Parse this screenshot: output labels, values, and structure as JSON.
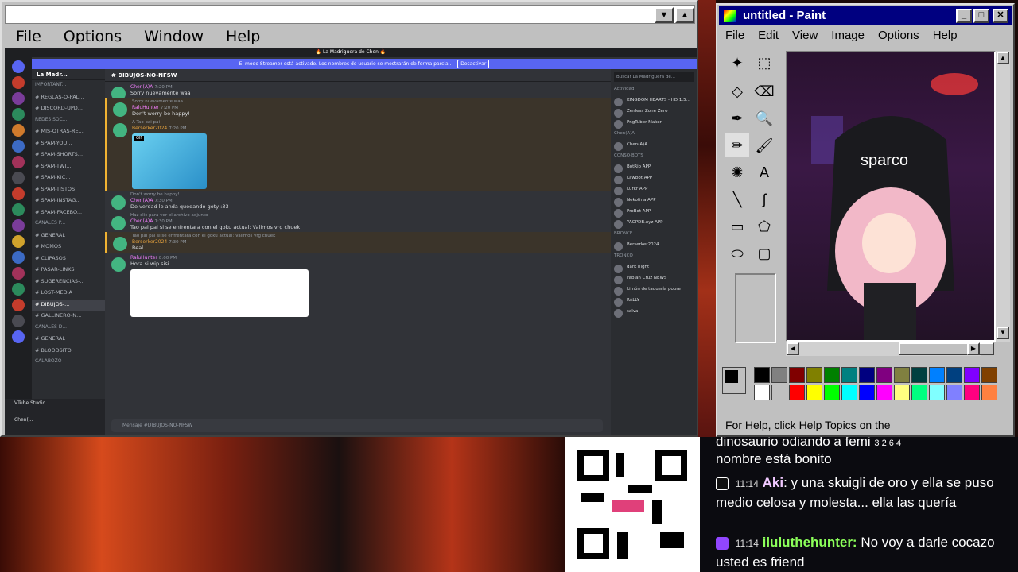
{
  "left_window": {
    "menu": [
      "File",
      "Options",
      "Window",
      "Help"
    ],
    "buttons": [
      "▼",
      "▲"
    ]
  },
  "discord": {
    "top_title": "🔥 La Madriguera de Chen 🔥",
    "banner_text": "El modo Streamer está activado. Los nombres de usuario se mostrarán de forma parcial.",
    "banner_button": "Desactivar",
    "server_name": "La Madr...",
    "channels": [
      {
        "label": "IMPORTANT...",
        "type": "cat"
      },
      {
        "label": "# REGLAS-O-PAL...",
        "type": "ch"
      },
      {
        "label": "# DISCORD-UPD...",
        "type": "ch"
      },
      {
        "label": "REDES SOC...",
        "type": "cat"
      },
      {
        "label": "# MIS-OTRAS-RE...",
        "type": "ch"
      },
      {
        "label": "# SPAM-YOU...",
        "type": "ch"
      },
      {
        "label": "# SPAM-SHORTS...",
        "type": "ch"
      },
      {
        "label": "# SPAM-TWI...",
        "type": "ch"
      },
      {
        "label": "# SPAM-KIC...",
        "type": "ch"
      },
      {
        "label": "# SPAM-TISTOS",
        "type": "ch"
      },
      {
        "label": "# SPAM-INSTAG...",
        "type": "ch"
      },
      {
        "label": "# SPAM-FACEBO...",
        "type": "ch"
      },
      {
        "label": "CANALES P...",
        "type": "cat"
      },
      {
        "label": "# GENERAL",
        "type": "ch"
      },
      {
        "label": "# MOMOS",
        "type": "ch"
      },
      {
        "label": "# CLIPASOS",
        "type": "ch"
      },
      {
        "label": "# PASAR-LINKS",
        "type": "ch"
      },
      {
        "label": "# SUGERENCIAS-...",
        "type": "ch"
      },
      {
        "label": "# LOST-MEDIA",
        "type": "ch"
      },
      {
        "label": "# DIBUJOS-...",
        "type": "active"
      },
      {
        "label": "# GALLINERO-N...",
        "type": "ch"
      },
      {
        "label": "CANALES D...",
        "type": "cat"
      },
      {
        "label": "# GENERAL",
        "type": "ch"
      },
      {
        "label": "# BLOODSITO",
        "type": "ch"
      },
      {
        "label": "CALABOZO",
        "type": "cat"
      }
    ],
    "vtube": "VTube Studio",
    "user_name": "Chen(...",
    "channel_title": "DIBUJOS-NO-NFSW",
    "messages": [
      {
        "name": "Chen(A)A",
        "time": "7:20 PM",
        "text": "Sorry nuevamente waa",
        "hl": false
      },
      {
        "reply": "Sorry nuevamente waa",
        "name": "RaluHunter",
        "time": "7:20 PM",
        "text": "Don't worry be happy!",
        "hl": true
      },
      {
        "reply": "A Tao pai pai",
        "name": "Berserker2024",
        "time": "7:20 PM",
        "text": "",
        "gif": "GIF",
        "hl": true
      },
      {
        "reply": "Don't worry be happy!",
        "name": "Chen(A)A",
        "time": "7:30 PM",
        "text": "De verdad le anda quedando goty :33",
        "hl": false
      },
      {
        "reply": "Haz clic para ver el archivo adjunto",
        "name": "Chen(A)A",
        "time": "7:30 PM",
        "text": "Tao pai pai si se enfrentara con el goku actual: Valimos vrg chuek",
        "hl": false
      },
      {
        "reply": "Tao pai pai si se enfrentara con el goku actual: Valimos vrg chuek",
        "name": "Berserker2024",
        "time": "7:30 PM",
        "text": "Real",
        "hl": true
      },
      {
        "name": "RaluHunter",
        "time": "8:00 PM",
        "text": "Hora si wip sisi",
        "sketch": true,
        "hl": false
      }
    ],
    "composer_placeholder": "Mensaje #DIBUJOS-NO-NFSW",
    "search_placeholder": "Buscar La Madriguera de...",
    "members": [
      {
        "label": "Actividad",
        "type": "sec"
      },
      {
        "label": "KINGDOM HEARTS - HD 1.5...",
        "type": "m"
      },
      {
        "label": "Zenless Zone Zero",
        "type": "m"
      },
      {
        "label": "PngTuber Maker",
        "type": "m"
      },
      {
        "label": "Chen(A)A",
        "type": "sec"
      },
      {
        "label": "Chen(A)A",
        "type": "m"
      },
      {
        "label": "CONSO-BOTS",
        "type": "sec"
      },
      {
        "label": "BotRio APP",
        "type": "m"
      },
      {
        "label": "Lawbot APP",
        "type": "m"
      },
      {
        "label": "Lurkr APP",
        "type": "m"
      },
      {
        "label": "Nekotina APP",
        "type": "m"
      },
      {
        "label": "ProBot APP",
        "type": "m"
      },
      {
        "label": "YAGPDB.xyz APP",
        "type": "m"
      },
      {
        "label": "BRONCE",
        "type": "sec"
      },
      {
        "label": "Berserker2024",
        "type": "m"
      },
      {
        "label": "TRONCO",
        "type": "sec"
      },
      {
        "label": "dark night",
        "type": "m"
      },
      {
        "label": "Fabian Cruz NEWS",
        "type": "m"
      },
      {
        "label": "Limón de taquería pobre",
        "type": "m"
      },
      {
        "label": "RALLY",
        "type": "m"
      },
      {
        "label": "salva",
        "type": "m"
      }
    ]
  },
  "paint": {
    "title": "untitled - Paint",
    "menu": [
      "File",
      "Edit",
      "View",
      "Image",
      "Options",
      "Help"
    ],
    "tools": [
      "✦",
      "⬚",
      "◇",
      "⌫",
      "✒",
      "🔍",
      "✏",
      "🖌",
      "✺",
      "A",
      "╲",
      "ʃ",
      "▭",
      "⬠",
      "⬭",
      "▢"
    ],
    "status_text": "For Help, click Help Topics on the",
    "canvas_text": "sparco",
    "palette_colors": [
      "#000000",
      "#808080",
      "#800000",
      "#808000",
      "#008000",
      "#008080",
      "#000080",
      "#800080",
      "#808040",
      "#004040",
      "#0080ff",
      "#004080",
      "#8000ff",
      "#804000",
      "#ffffff",
      "#c0c0c0",
      "#ff0000",
      "#ffff00",
      "#00ff00",
      "#00ffff",
      "#0000ff",
      "#ff00ff",
      "#ffff80",
      "#00ff80",
      "#80ffff",
      "#8080ff",
      "#ff0080",
      "#ff8040"
    ]
  },
  "chat": {
    "line0a": "dinosaurio odiando a femi",
    "line0b": "nombre está bonito",
    "msg1_time": "11:14",
    "msg1_name": "Aki",
    "msg1_text": ": y una skuigli de oro y ella se puso medio celosa y molesta... ella las quería",
    "msg2_time": "11:14",
    "msg2_name": "iluluthehunter:",
    "msg2_text": "No voy a darle cocazo usted es friend",
    "counts": [
      "3",
      "2",
      "6",
      "4"
    ]
  }
}
